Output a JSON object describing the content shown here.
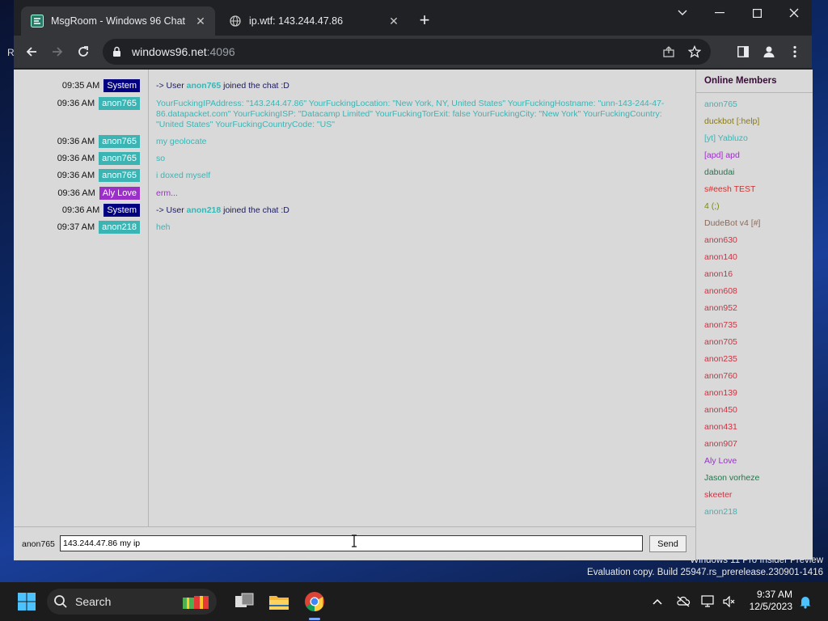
{
  "browser": {
    "tabs": [
      {
        "title": "MsgRoom - Windows 96 Chat",
        "active": true,
        "favicon": "msgroom-icon"
      },
      {
        "title": "ip.wtf: 143.244.47.86",
        "active": false,
        "favicon": "globe-icon"
      }
    ],
    "url_host": "windows96.net",
    "url_port": ":4096",
    "edge_fragment": "R"
  },
  "chat": {
    "rows": [
      {
        "time": "09:35 AM",
        "user": "System",
        "color": "#000080",
        "type": "system",
        "pre": "-> User ",
        "name": "anon765",
        "post": " joined the chat :D"
      },
      {
        "time": "09:36 AM",
        "user": "anon765",
        "color": "#3cb4b4",
        "type": "msg",
        "text": "YourFuckingIPAddress: \"143.244.47.86\" YourFuckingLocation: \"New York, NY, United States\" YourFuckingHostname: \"unn-143-244-47-86.datapacket.com\" YourFuckingISP: \"Datacamp Limited\" YourFuckingTorExit: false YourFuckingCity: \"New York\" YourFuckingCountry: \"United States\" YourFuckingCountryCode: \"US\""
      },
      {
        "time": "09:36 AM",
        "user": "anon765",
        "color": "#3cb4b4",
        "type": "msg",
        "text": "my geolocate"
      },
      {
        "time": "09:36 AM",
        "user": "anon765",
        "color": "#3cb4b4",
        "type": "msg",
        "text": "so"
      },
      {
        "time": "09:36 AM",
        "user": "anon765",
        "color": "#3cb4b4",
        "type": "msg",
        "text": "i doxed myself"
      },
      {
        "time": "09:36 AM",
        "user": "Aly Love",
        "color": "#9b30c8",
        "type": "msg",
        "text": "erm..."
      },
      {
        "time": "09:36 AM",
        "user": "System",
        "color": "#000080",
        "type": "system",
        "pre": "-> User ",
        "name": "anon218",
        "post": " joined the chat :D"
      },
      {
        "time": "09:37 AM",
        "user": "anon218",
        "color": "#3cb4b4",
        "type": "msg",
        "text": "heh"
      }
    ]
  },
  "members": {
    "title": "Online Members",
    "list": [
      {
        "name": "anon765",
        "color": "#3cb4b4"
      },
      {
        "name": "duckbot [:help]",
        "color": "#8a7a10"
      },
      {
        "name": "[yt] Yabluzo",
        "color": "#3cb4b4"
      },
      {
        "name": "[apd] apd",
        "color": "#9b30c8"
      },
      {
        "name": "dabudai",
        "color": "#1a7a4a"
      },
      {
        "name": "s#eesh TEST",
        "color": "#d03030"
      },
      {
        "name": "4 (;)",
        "color": "#7a8a10"
      },
      {
        "name": "DudeBot v4 [#]",
        "color": "#8a6a5a"
      },
      {
        "name": "anon630",
        "color": "#d03040"
      },
      {
        "name": "anon140",
        "color": "#d03040"
      },
      {
        "name": "anon16",
        "color": "#d03040"
      },
      {
        "name": "anon608",
        "color": "#d03040"
      },
      {
        "name": "anon952",
        "color": "#d03040"
      },
      {
        "name": "anon735",
        "color": "#d03040"
      },
      {
        "name": "anon705",
        "color": "#d03040"
      },
      {
        "name": "anon235",
        "color": "#d03040"
      },
      {
        "name": "anon760",
        "color": "#d03040"
      },
      {
        "name": "anon139",
        "color": "#d03040"
      },
      {
        "name": "anon450",
        "color": "#d03040"
      },
      {
        "name": "anon431",
        "color": "#d03040"
      },
      {
        "name": "anon907",
        "color": "#d03040"
      },
      {
        "name": "Aly Love",
        "color": "#9b30c8"
      },
      {
        "name": "Jason vorheze",
        "color": "#1a7a4a"
      },
      {
        "name": "skeeter",
        "color": "#d03040"
      },
      {
        "name": "anon218",
        "color": "#3cb4b4"
      }
    ]
  },
  "input": {
    "username": "anon765",
    "value": "143.244.47.86 my ip",
    "send_label": "Send"
  },
  "desktop": {
    "watermark_line1": "Windows 11 Pro Insider Preview",
    "watermark_line2": "Evaluation copy. Build 25947.rs_prerelease.230901-1416"
  },
  "taskbar": {
    "search_label": "Search",
    "time": "9:37 AM",
    "date": "12/5/2023"
  }
}
